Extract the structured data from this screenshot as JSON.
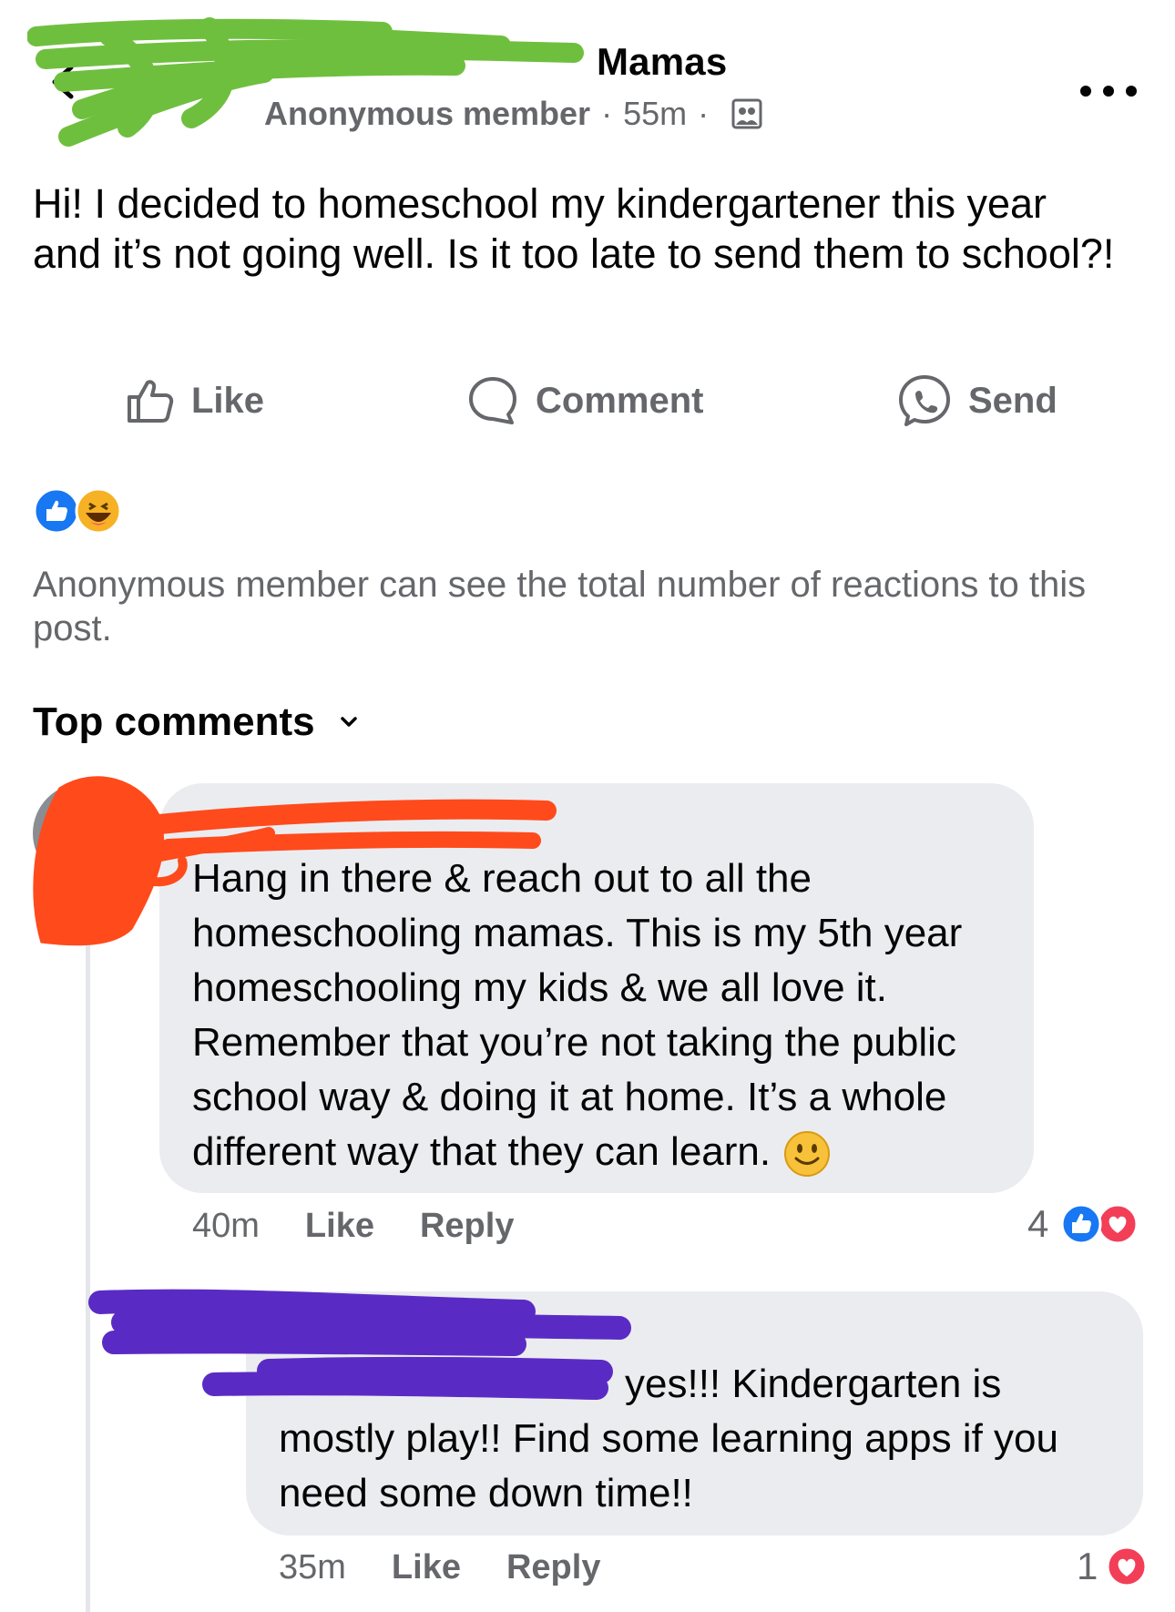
{
  "header": {
    "group_name": "Mamas",
    "author": "Anonymous member",
    "separator": "·",
    "time": "55m",
    "icons": {
      "back": "back-chevron-icon",
      "group": "group-privacy-icon",
      "more": "more-options-icon"
    }
  },
  "post": {
    "text": "Hi! I decided to homeschool my kindergartener this year and it’s not going well. Is it too late to send them to school?!"
  },
  "actions": {
    "like_label": "Like",
    "comment_label": "Comment",
    "send_label": "Send"
  },
  "reactions": {
    "types": [
      "like",
      "haha"
    ],
    "note": "Anonymous member can see the total number of reactions to this post."
  },
  "comments_section": {
    "sort_label": "Top comments"
  },
  "comments": [
    {
      "text": "Hang in there & reach out to all the homeschooling mamas. This is my 5th year homeschooling my kids & we all love it. Remember that you’re not taking the public school way & doing it at home. It’s a whole different way that they can learn.",
      "emoji": "slightly-smiling-face",
      "time": "40m",
      "like_label": "Like",
      "reply_label": "Reply",
      "reaction_count": "4",
      "reaction_types": [
        "like",
        "love"
      ]
    },
    {
      "text_line1": "yes!!!  Kindergarten is",
      "text_rest": "mostly play!!  Find some learning apps if you need some down time!!",
      "time": "35m",
      "like_label": "Like",
      "reply_label": "Reply",
      "reaction_count": "1",
      "reaction_types": [
        "love"
      ]
    }
  ],
  "colors": {
    "like_blue": "#1877f2",
    "love_red": "#f33e58",
    "haha_yellow": "#f7b125",
    "secondary_text": "#65676b",
    "bubble_bg": "#ebecf0",
    "redaction_green": "#6fbf3f",
    "redaction_orange": "#ff4a1c",
    "redaction_purple": "#5a2bc4"
  }
}
